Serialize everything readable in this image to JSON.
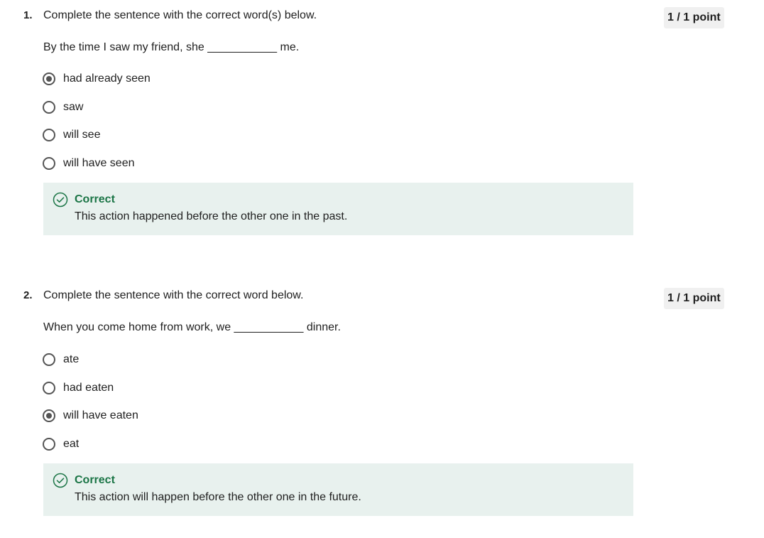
{
  "questions": [
    {
      "number": "1.",
      "prompt": "Complete the sentence with the correct word(s) below.",
      "score": "1 / 1 point",
      "sentence": "By the time I saw my friend, she ___________ me.",
      "options": [
        {
          "label": "had already seen",
          "selected": true
        },
        {
          "label": "saw",
          "selected": false
        },
        {
          "label": "will see",
          "selected": false
        },
        {
          "label": "will have seen",
          "selected": false
        }
      ],
      "feedback": {
        "icon": "check-circle-icon",
        "title": "Correct",
        "text": "This action happened before the other one in the past."
      }
    },
    {
      "number": "2.",
      "prompt": "Complete the sentence with the correct word below.",
      "score": "1 / 1 point",
      "sentence": "When you come home from work, we ___________ dinner.",
      "options": [
        {
          "label": "ate",
          "selected": false
        },
        {
          "label": "had eaten",
          "selected": false
        },
        {
          "label": "will have eaten",
          "selected": true
        },
        {
          "label": "eat",
          "selected": false
        }
      ],
      "feedback": {
        "icon": "check-circle-icon",
        "title": "Correct",
        "text": "This action will happen before the other one in the future."
      }
    }
  ],
  "colors": {
    "feedback_bg": "#e8f1ee",
    "correct_green": "#1b7546",
    "score_badge_bg": "#f0f0f0",
    "radio_border": "#545454"
  }
}
